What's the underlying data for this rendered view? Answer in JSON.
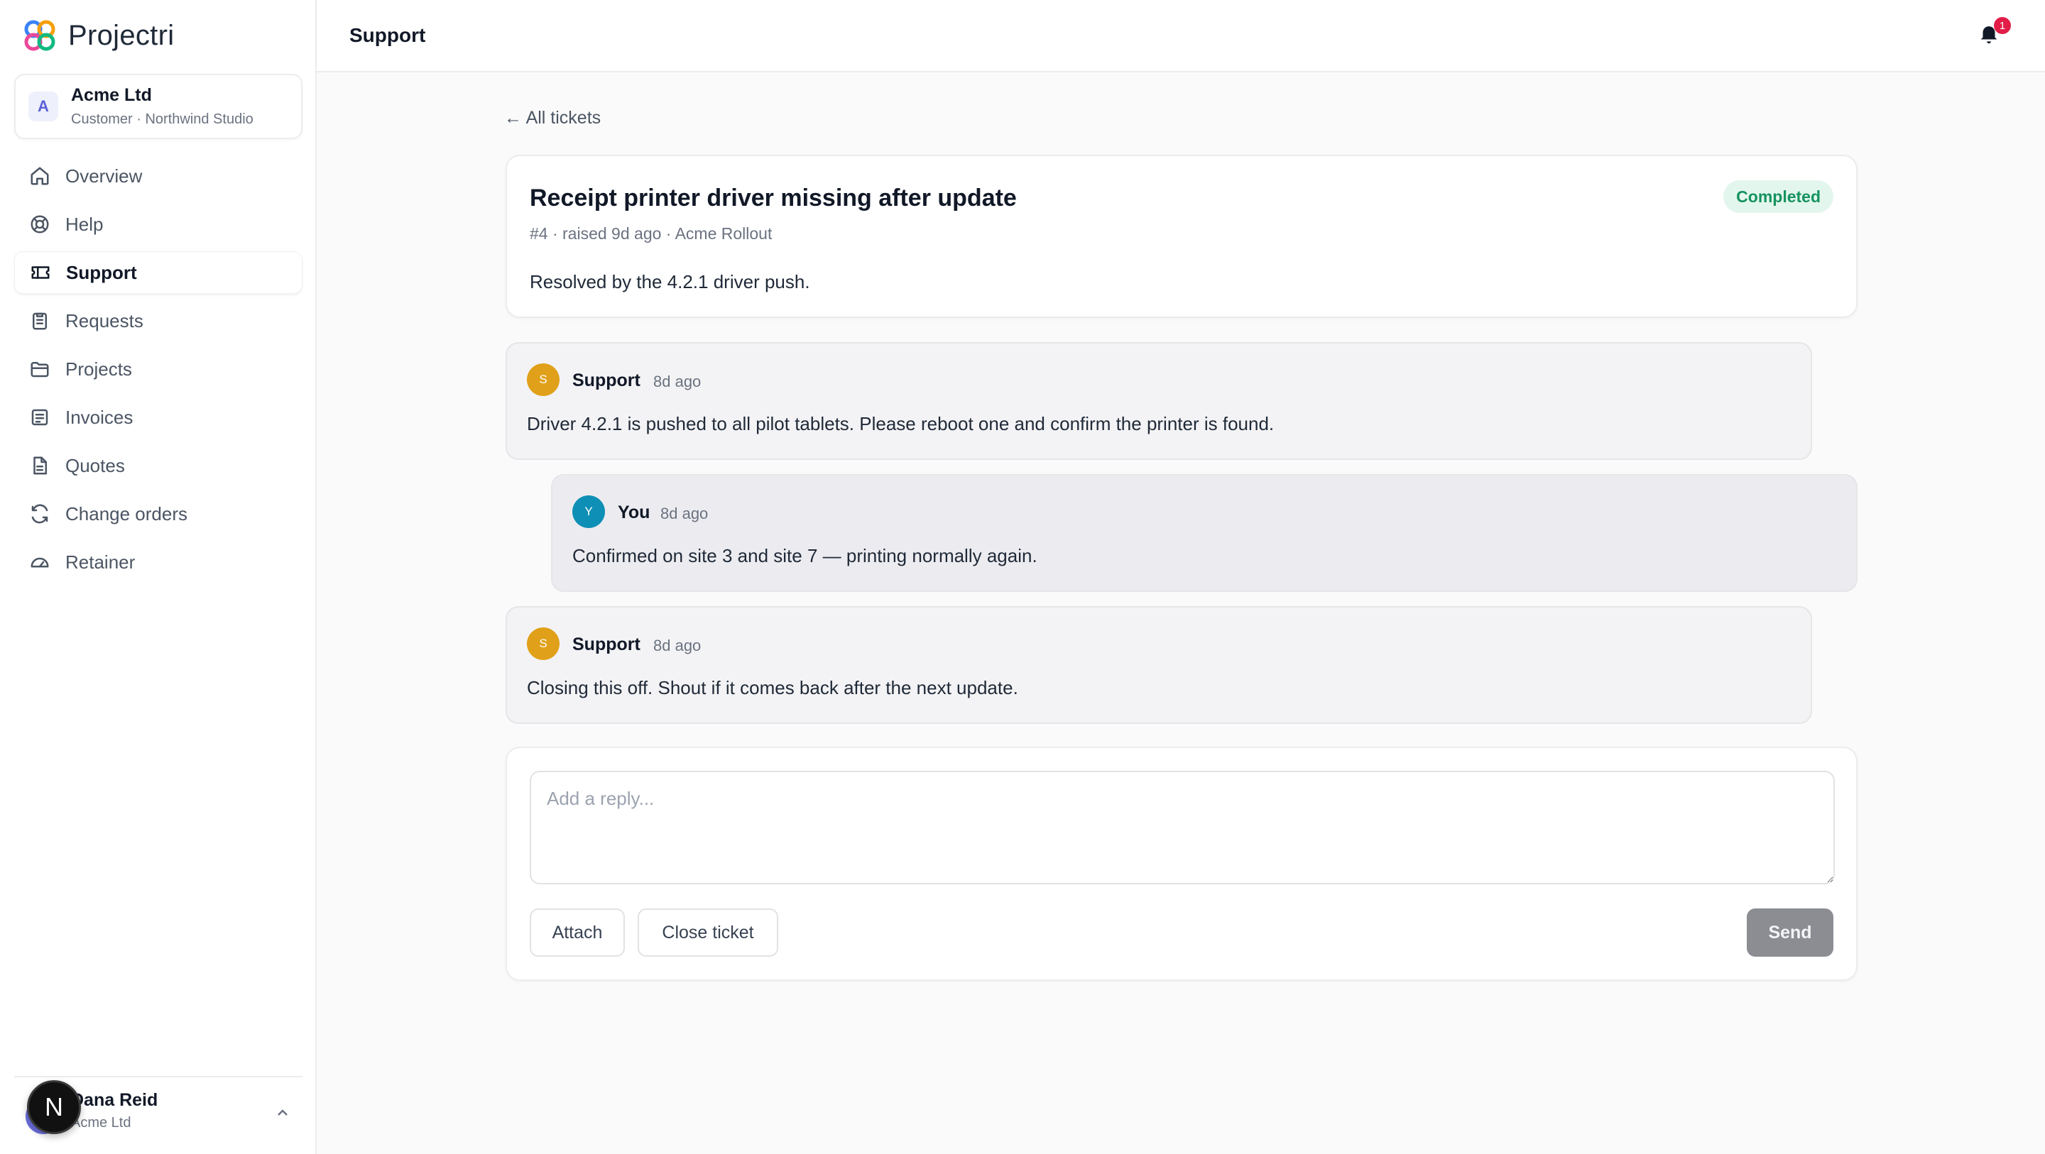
{
  "app": {
    "name": "Projectri"
  },
  "org": {
    "initial": "A",
    "name": "Acme Ltd",
    "subtitle": "Customer · Northwind Studio"
  },
  "nav": [
    {
      "label": "Overview",
      "icon": "home-icon"
    },
    {
      "label": "Help",
      "icon": "lifebuoy-icon"
    },
    {
      "label": "Support",
      "icon": "ticket-icon",
      "active": true
    },
    {
      "label": "Requests",
      "icon": "clipboard-icon"
    },
    {
      "label": "Projects",
      "icon": "folder-icon"
    },
    {
      "label": "Invoices",
      "icon": "receipt-icon"
    },
    {
      "label": "Quotes",
      "icon": "document-icon"
    },
    {
      "label": "Change orders",
      "icon": "refresh-icon"
    },
    {
      "label": "Retainer",
      "icon": "gauge-icon"
    }
  ],
  "user": {
    "name": "Dana Reid",
    "org": "Acme Ltd",
    "badge": "N"
  },
  "header": {
    "title": "Support",
    "notification_count": "1"
  },
  "back_link": "← All tickets",
  "ticket": {
    "title": "Receipt printer driver missing after update",
    "meta": "#4 · raised 9d ago · Acme Rollout",
    "description": "Resolved by the 4.2.1 driver push.",
    "status": "Completed"
  },
  "messages": [
    {
      "initial": "S",
      "author": "Support",
      "time": "8d ago",
      "body": "Driver 4.2.1 is pushed to all pilot tablets. Please reboot one and confirm the printer is found.",
      "color": "#e0a019"
    },
    {
      "initial": "Y",
      "author": "You",
      "time": "8d ago",
      "body": "Confirmed on site 3 and site 7 — printing normally again.",
      "color": "#0e8fb5"
    },
    {
      "initial": "S",
      "author": "Support",
      "time": "8d ago",
      "body": "Closing this off. Shout if it comes back after the next update.",
      "color": "#e0a019"
    }
  ],
  "reply": {
    "placeholder": "Add a reply...",
    "attach_label": "Attach",
    "close_label": "Close ticket",
    "send_label": "Send"
  },
  "colors": {
    "status_bg": "#e3f6ee",
    "status_text": "#15935e",
    "badge": "#e11d48"
  }
}
